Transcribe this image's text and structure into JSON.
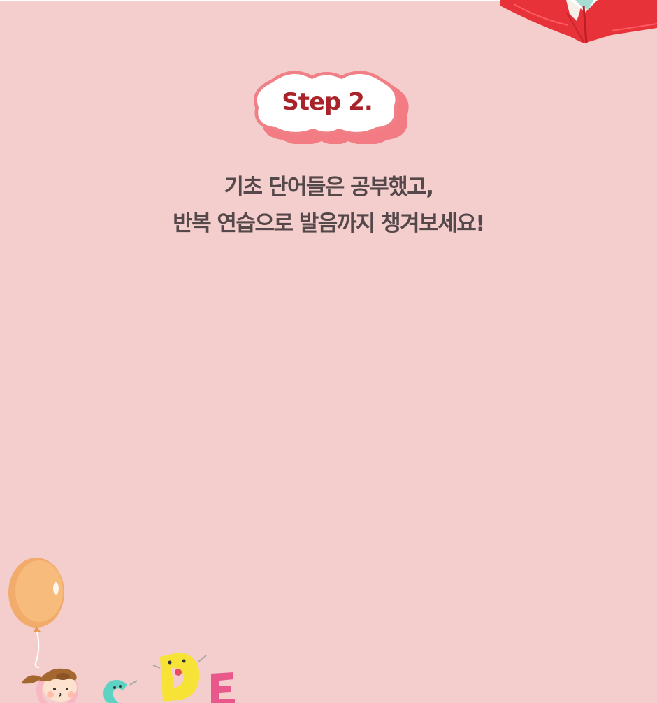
{
  "step_badge": {
    "label": "Step 2.",
    "colors": {
      "text": "#a8232a",
      "fill": "#ffffff",
      "outline": "#f07f86",
      "shadow": "#f37b84"
    }
  },
  "headline": {
    "line1": "기초 단어들은 공부했고,",
    "line2": "반복 연습으로 발음까지 챙겨보세요!"
  },
  "decorations": {
    "top_right": "open-red-book-icon",
    "bottom_left": [
      "orange-balloon-icon",
      "child-character-icon",
      "letter-c-character-icon",
      "letter-d-character-icon",
      "letter-e-character-icon"
    ]
  },
  "colors": {
    "background": "#f4cecd",
    "headline_text": "#55484a"
  }
}
